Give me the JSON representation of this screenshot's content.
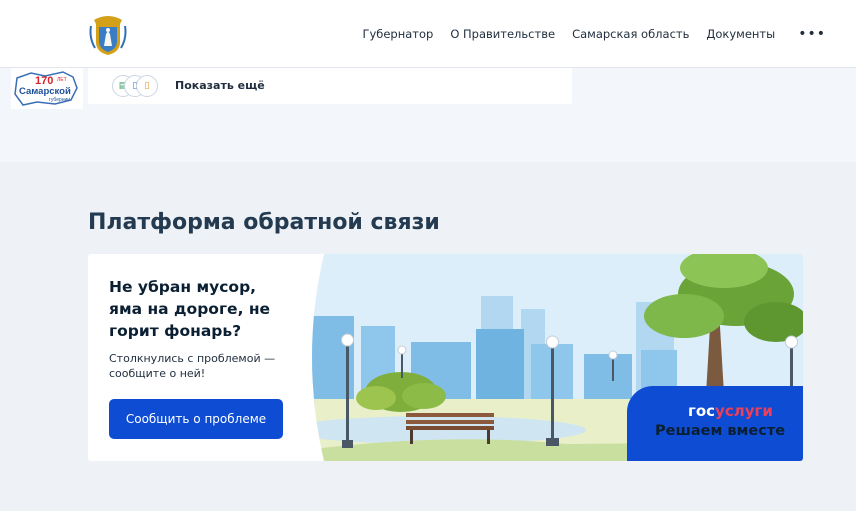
{
  "header": {
    "nav": [
      "Губернатор",
      "О Правительстве",
      "Самарская область",
      "Документы"
    ],
    "more_label": "•••"
  },
  "anniversary_logo": {
    "number": "170",
    "years": "ЛЕТ",
    "name": "Самарской",
    "sub": "губернии"
  },
  "documents_strip": {
    "show_more_label": "Показать ещё"
  },
  "feedback": {
    "section_title": "Платформа обратной связи",
    "heading": "Не убран мусор, яма на дороге, не горит фонарь?",
    "text": "Столкнулись с проблемой — сообщите о ней!",
    "button_label": "Сообщить о проблеме",
    "gosuslugi_part1": "гос",
    "gosuslugi_part2": "услуги",
    "slogan": "Решаем вместе"
  },
  "colors": {
    "accent": "#0d4cd3",
    "gosuslugi_red": "#ee3f58",
    "title": "#233a50",
    "background": "#eef2f7"
  }
}
